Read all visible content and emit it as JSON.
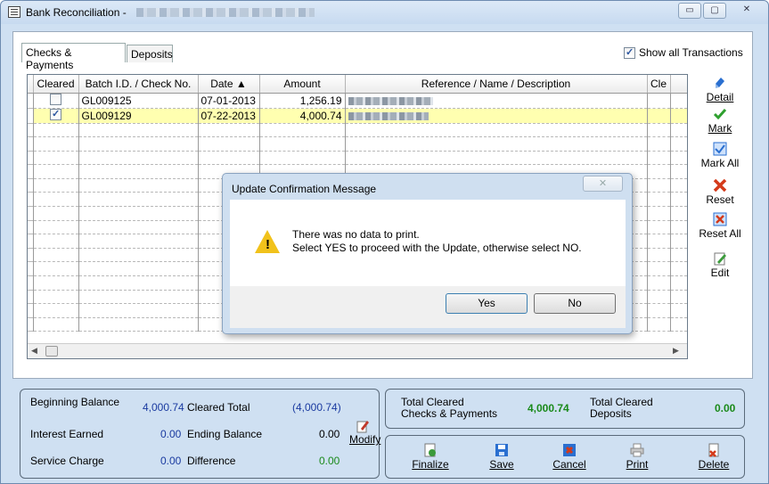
{
  "window": {
    "title": "Bank Reconciliation -",
    "title_blurred": "(redacted)",
    "min_glyph": "▭",
    "max_glyph": "▢",
    "close_glyph": "✕"
  },
  "tabs": [
    {
      "label": "Checks & Payments"
    },
    {
      "label": "Deposits"
    }
  ],
  "show_all": {
    "label": "Show all Transactions",
    "checked": true
  },
  "grid": {
    "columns": [
      "Cleared",
      "Batch I.D. / Check No.",
      "Date ▲",
      "Amount",
      "Reference / Name / Description",
      "Cle"
    ],
    "rows": [
      {
        "cleared": false,
        "batch": "GL009125",
        "date": "07-01-2013",
        "amount": "1,256.19",
        "selected": false
      },
      {
        "cleared": true,
        "batch": "GL009129",
        "date": "07-22-2013",
        "amount": "4,000.74",
        "selected": true
      }
    ],
    "scroll_left": "◀",
    "scroll_right": "▶"
  },
  "side_buttons": [
    {
      "label": "Detail",
      "ul": "D",
      "icon": "detail-icon"
    },
    {
      "label": "Mark",
      "ul": "M",
      "icon": "mark-icon"
    },
    {
      "label": "Mark All",
      "ul": "k",
      "icon": "mark-all-icon"
    },
    {
      "label": "Reset",
      "ul": "e",
      "icon": "reset-icon"
    },
    {
      "label": "Reset All",
      "ul": "A",
      "icon": "reset-all-icon"
    },
    {
      "label": "Edit",
      "ul": "E",
      "icon": "edit-icon"
    }
  ],
  "dialog": {
    "title": "Update Confirmation Message",
    "close_glyph": "✕",
    "line1": "There was no data to print.",
    "line2": "Select YES to proceed with the Update, otherwise select NO.",
    "yes": "Yes",
    "no": "No",
    "warn_glyph": "!"
  },
  "summary": {
    "beginning_balance_label": "Beginning Balance",
    "beginning_balance": "4,000.74",
    "cleared_total_label": "Cleared Total",
    "cleared_total": "(4,000.74)",
    "interest_earned_label": "Interest Earned",
    "interest_earned": "0.00",
    "ending_balance_label": "Ending Balance",
    "ending_balance": "0.00",
    "service_charge_label": "Service Charge",
    "service_charge": "0.00",
    "difference_label": "Difference",
    "difference": "0.00",
    "modify_label": "Modify"
  },
  "totals": {
    "cleared_cp_label_1": "Total Cleared",
    "cleared_cp_label_2": "Checks & Payments",
    "cleared_cp_value": "4,000.74",
    "cleared_dep_label_1": "Total Cleared",
    "cleared_dep_label_2": "Deposits",
    "cleared_dep_value": "0.00"
  },
  "bottom_buttons": [
    {
      "label": "Finalize",
      "icon": "finalize-icon"
    },
    {
      "label": "Save",
      "icon": "save-icon"
    },
    {
      "label": "Cancel",
      "icon": "cancel-icon"
    },
    {
      "label": "Print",
      "icon": "print-icon"
    },
    {
      "label": "Delete",
      "icon": "delete-icon"
    }
  ],
  "colors": {
    "accent": "#1a3aa0",
    "positive": "#1a8a1a",
    "highlight": "#ffffb0",
    "chrome": "#cfe0f2"
  }
}
